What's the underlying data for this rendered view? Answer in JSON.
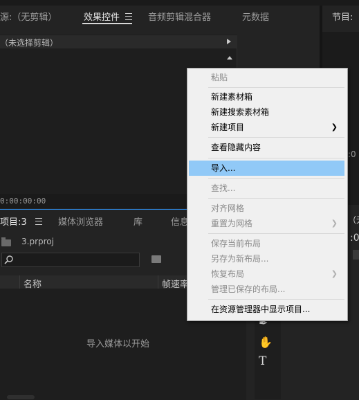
{
  "top_tabs": {
    "source": "源:（无剪辑）",
    "effects": "效果控件",
    "audio_mixer": "音频剪辑混合器",
    "metadata": "元数据",
    "program": "节目:"
  },
  "effects_panel": {
    "no_clip": "（未选择剪辑）",
    "timecode": "0:00:00:00"
  },
  "project_panel": {
    "tabs": {
      "project": "项目:3",
      "media_browser": "媒体浏览器",
      "library": "库",
      "info": "信息"
    },
    "file_name": "3.prproj",
    "columns": {
      "name": "名称",
      "frame_rate": "帧速率"
    },
    "empty_hint": "导入媒体以开始"
  },
  "right_partial": {
    "label_none": "（无",
    "colon_fragment": ":0",
    "colon_fragment2": ":00"
  },
  "context_menu": {
    "items": [
      {
        "label": "粘贴",
        "disabled": true,
        "submenu": false
      },
      {
        "label": "新建素材箱",
        "disabled": false,
        "submenu": false
      },
      {
        "label": "新建搜索素材箱",
        "disabled": false,
        "submenu": false
      },
      {
        "label": "新建项目",
        "disabled": false,
        "submenu": true
      },
      {
        "label": "查看隐藏内容",
        "disabled": false,
        "submenu": false
      },
      {
        "label": "导入...",
        "disabled": false,
        "submenu": false,
        "highlighted": true
      },
      {
        "label": "查找...",
        "disabled": true,
        "submenu": false
      },
      {
        "label": "对齐网格",
        "disabled": true,
        "submenu": false
      },
      {
        "label": "重置为网格",
        "disabled": true,
        "submenu": true
      },
      {
        "label": "保存当前布局",
        "disabled": true,
        "submenu": false
      },
      {
        "label": "另存为新布局...",
        "disabled": true,
        "submenu": false
      },
      {
        "label": "恢复布局",
        "disabled": true,
        "submenu": true
      },
      {
        "label": "管理已保存的布局...",
        "disabled": true,
        "submenu": false
      },
      {
        "label": "在资源管理器中显示项目...",
        "disabled": false,
        "submenu": false
      }
    ]
  },
  "tools": {
    "pen": "pen-icon",
    "hand": "hand-icon",
    "type": "T"
  },
  "colors": {
    "menu_highlight": "#91c9f7",
    "panel_border_blue": "#2d8ceb"
  }
}
